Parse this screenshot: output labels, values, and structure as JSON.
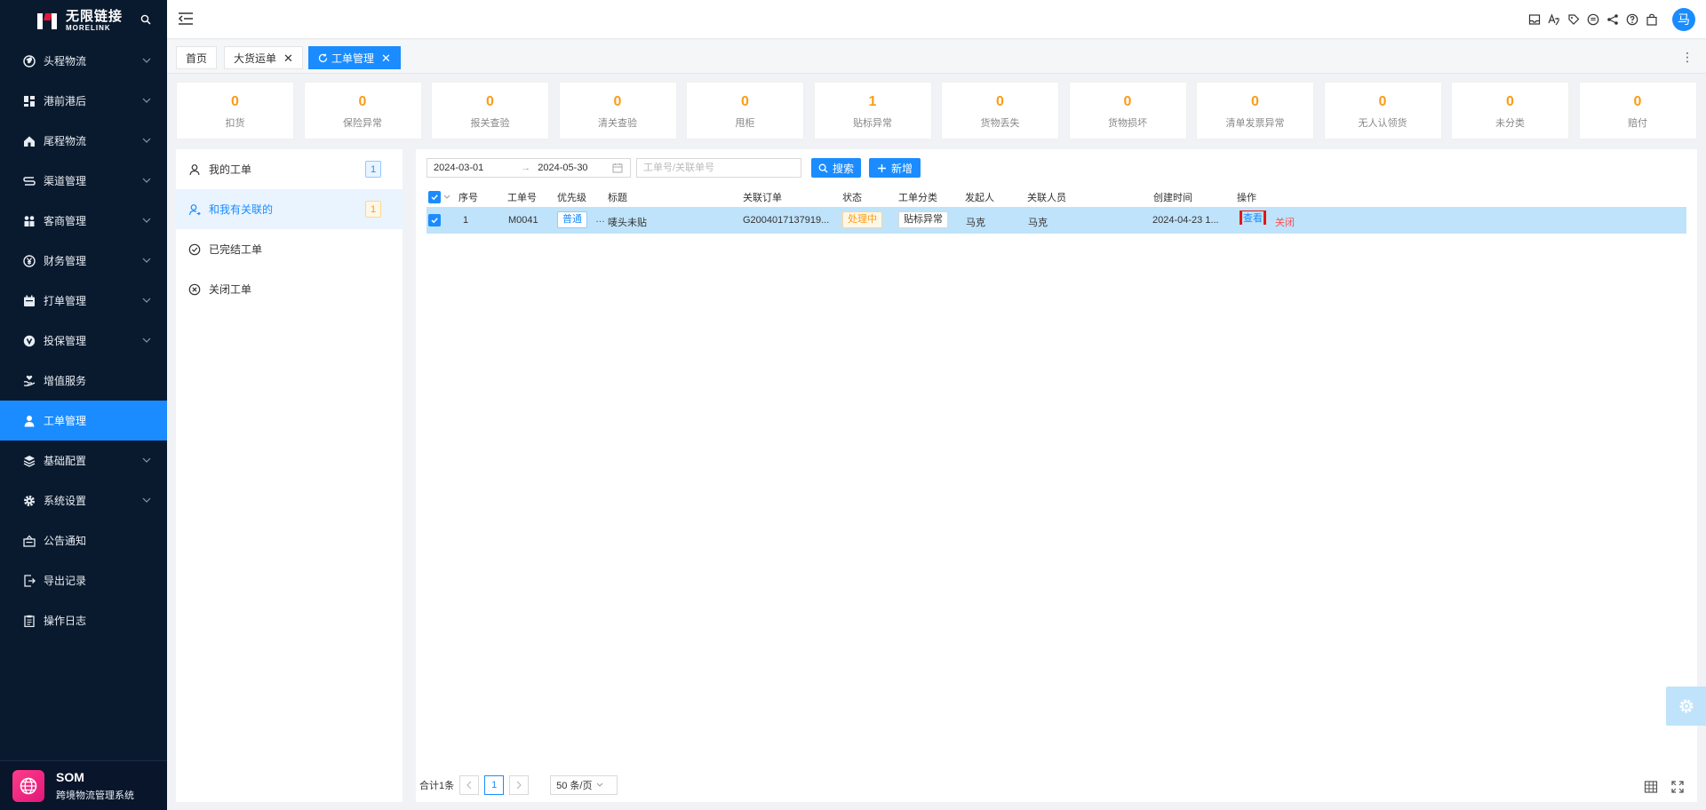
{
  "sidebar": {
    "logo_cn": "无限链接",
    "logo_en": "MORELINK",
    "items": [
      {
        "label": "头程物流",
        "icon": "globe-icon",
        "chevron": true
      },
      {
        "label": "港前港后",
        "icon": "grid-icon",
        "chevron": true
      },
      {
        "label": "尾程物流",
        "icon": "house-icon",
        "chevron": true
      },
      {
        "label": "渠道管理",
        "icon": "channel-icon",
        "chevron": true
      },
      {
        "label": "客商管理",
        "icon": "users-icon",
        "chevron": true
      },
      {
        "label": "财务管理",
        "icon": "yen-icon",
        "chevron": true
      },
      {
        "label": "打单管理",
        "icon": "calendar-icon",
        "chevron": true
      },
      {
        "label": "投保管理",
        "icon": "shield-icon",
        "chevron": true
      },
      {
        "label": "增值服务",
        "icon": "hand-heart-icon",
        "chevron": false
      },
      {
        "label": "工单管理",
        "icon": "user-icon",
        "chevron": false,
        "active": true
      },
      {
        "label": "基础配置",
        "icon": "layers-icon",
        "chevron": true
      },
      {
        "label": "系统设置",
        "icon": "gear-icon",
        "chevron": true
      },
      {
        "label": "公告通知",
        "icon": "notice-icon",
        "chevron": false
      },
      {
        "label": "导出记录",
        "icon": "export-icon",
        "chevron": false
      },
      {
        "label": "操作日志",
        "icon": "clipboard-icon",
        "chevron": false
      }
    ],
    "footer": {
      "title": "SOM",
      "subtitle": "跨境物流管理系统"
    }
  },
  "header": {
    "avatar": "马"
  },
  "tabs": [
    {
      "label": "首页",
      "closable": false,
      "active": false
    },
    {
      "label": "大货运单",
      "closable": true,
      "active": false
    },
    {
      "label": "工单管理",
      "closable": true,
      "active": true
    }
  ],
  "stats": [
    {
      "value": "0",
      "label": "扣货"
    },
    {
      "value": "0",
      "label": "保险异常"
    },
    {
      "value": "0",
      "label": "报关查验"
    },
    {
      "value": "0",
      "label": "清关查验"
    },
    {
      "value": "0",
      "label": "甩柜"
    },
    {
      "value": "1",
      "label": "贴标异常"
    },
    {
      "value": "0",
      "label": "货物丢失"
    },
    {
      "value": "0",
      "label": "货物损坏"
    },
    {
      "value": "0",
      "label": "清单发票异常"
    },
    {
      "value": "0",
      "label": "无人认领货"
    },
    {
      "value": "0",
      "label": "未分类"
    },
    {
      "value": "0",
      "label": "赔付"
    }
  ],
  "subnav": [
    {
      "label": "我的工单",
      "count": "1",
      "badge": "blue"
    },
    {
      "label": "和我有关联的",
      "count": "1",
      "badge": "yellow",
      "selected": true
    },
    {
      "label": "已完结工单"
    },
    {
      "label": "关闭工单"
    }
  ],
  "filters": {
    "date_start": "2024-03-01",
    "date_end": "2024-05-30",
    "search_placeholder": "工单号/关联单号",
    "search_btn": "搜索",
    "add_btn": "新增"
  },
  "table": {
    "headers": [
      "序号",
      "工单号",
      "优先级",
      "标题",
      "关联订单",
      "状态",
      "工单分类",
      "发起人",
      "关联人员",
      "创建时间",
      "操作"
    ],
    "rows": [
      {
        "index": "1",
        "ticket_no": "M0041",
        "priority": "普通",
        "title": "唛头未贴",
        "order": "G2004017137919...",
        "status": "处理中",
        "category": "贴标异常",
        "initiator": "马克",
        "related": "马克",
        "created": "2024-04-23 1...",
        "op_view": "查看",
        "op_close": "关闭"
      }
    ]
  },
  "pagination": {
    "total": "合计1条",
    "current": "1",
    "page_size": "50 条/页"
  },
  "colors": {
    "accent": "#1a8cff",
    "sidebar": "#0a1a2e",
    "warning": "#fa9c16",
    "danger": "#ff4d4f"
  }
}
